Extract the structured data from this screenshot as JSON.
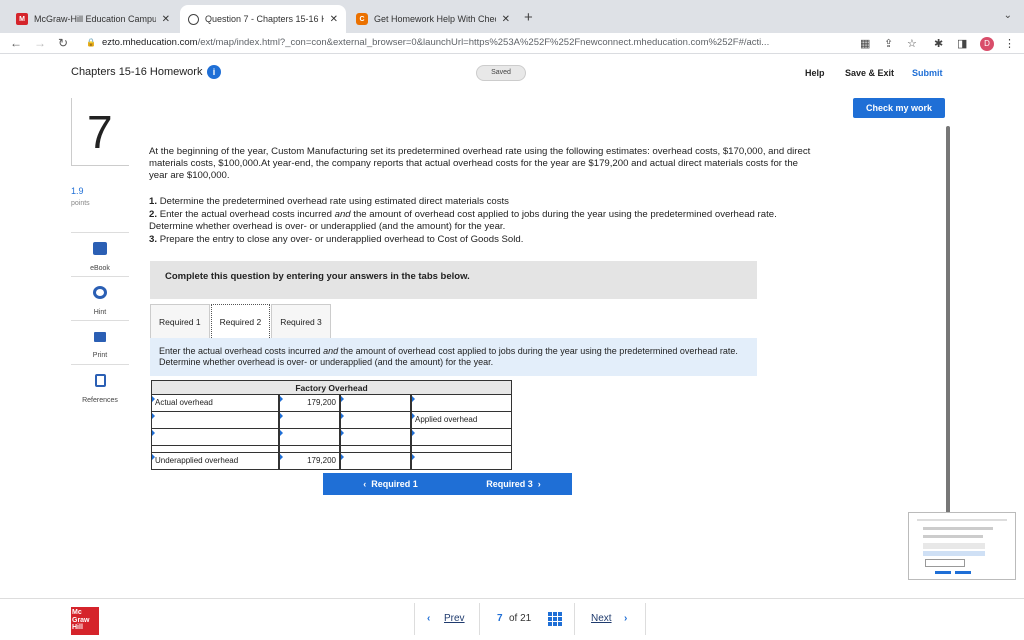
{
  "browser": {
    "tabs": [
      {
        "title": "McGraw-Hill Education Campu",
        "active": false,
        "favicon": "mcgraw-hill-favicon"
      },
      {
        "title": "Question 7 - Chapters 15-16 H",
        "active": true,
        "favicon": "globe-favicon"
      },
      {
        "title": "Get Homework Help With Chec",
        "active": false,
        "favicon": "chegg-favicon"
      }
    ],
    "url_host": "ezto.mheducation.com",
    "url_path": "/ext/map/index.html?_con=con&external_browser=0&launchUrl=https%253A%252F%252Fnewconnect.mheducation.com%252F#/acti...",
    "avatar_letter": "D",
    "accent": "#1f6fd6"
  },
  "header": {
    "title": "Chapters 15-16 Homework",
    "saved": "Saved",
    "help": "Help",
    "save_exit": "Save & Exit",
    "submit": "Submit",
    "check": "Check my work"
  },
  "rail": {
    "question_number": "7",
    "points": "1.9",
    "points_label": "points",
    "tools": [
      "eBook",
      "Hint",
      "Print",
      "References"
    ]
  },
  "question": {
    "intro": "At the beginning of the year, Custom Manufacturing set its predetermined overhead rate using the following estimates: overhead costs, $170,000, and direct materials costs, $100,000.At year-end, the company reports that actual overhead costs for the year are $179,200 and actual direct materials costs for the year are $100,000.",
    "step1": "Determine the predetermined overhead rate using estimated direct materials costs",
    "step2_a": "Enter the actual overhead costs incurred ",
    "step2_em": "and",
    "step2_b": " the amount of overhead cost applied to jobs during the year using the predetermined overhead rate. Determine whether overhead is over- or underapplied (and the amount) for the year.",
    "step3": "Prepare the entry to close any over- or underapplied overhead to Cost of Goods Sold.",
    "step_nums": [
      "1.",
      "2.",
      "3."
    ]
  },
  "banner": "Complete this question by entering your answers in the tabs below.",
  "req_tabs": [
    "Required 1",
    "Required 2",
    "Required 3"
  ],
  "instruction_a": "Enter the actual overhead costs incurred ",
  "instruction_em": "and",
  "instruction_b": " the amount of overhead cost applied to jobs during the year using the predetermined overhead rate. Determine whether overhead is over- or underapplied (and the amount) for the year.",
  "t_account": {
    "title": "Factory Overhead",
    "rows": [
      {
        "left_label": "Actual overhead",
        "left_value": "179,200",
        "right_value": "",
        "right_label": ""
      },
      {
        "left_label": "",
        "left_value": "",
        "right_value": "",
        "right_label": "Applied overhead"
      },
      {
        "left_label": "Underapplied overhead",
        "left_value": "179,200",
        "right_value": "",
        "right_label": ""
      }
    ]
  },
  "nav": {
    "prev_req": "Required 1",
    "next_req": "Required 3",
    "prev": "Prev",
    "next": "Next",
    "page": "7",
    "of": "of 21"
  },
  "footer_logo": [
    "Mc",
    "Graw",
    "Hill"
  ]
}
